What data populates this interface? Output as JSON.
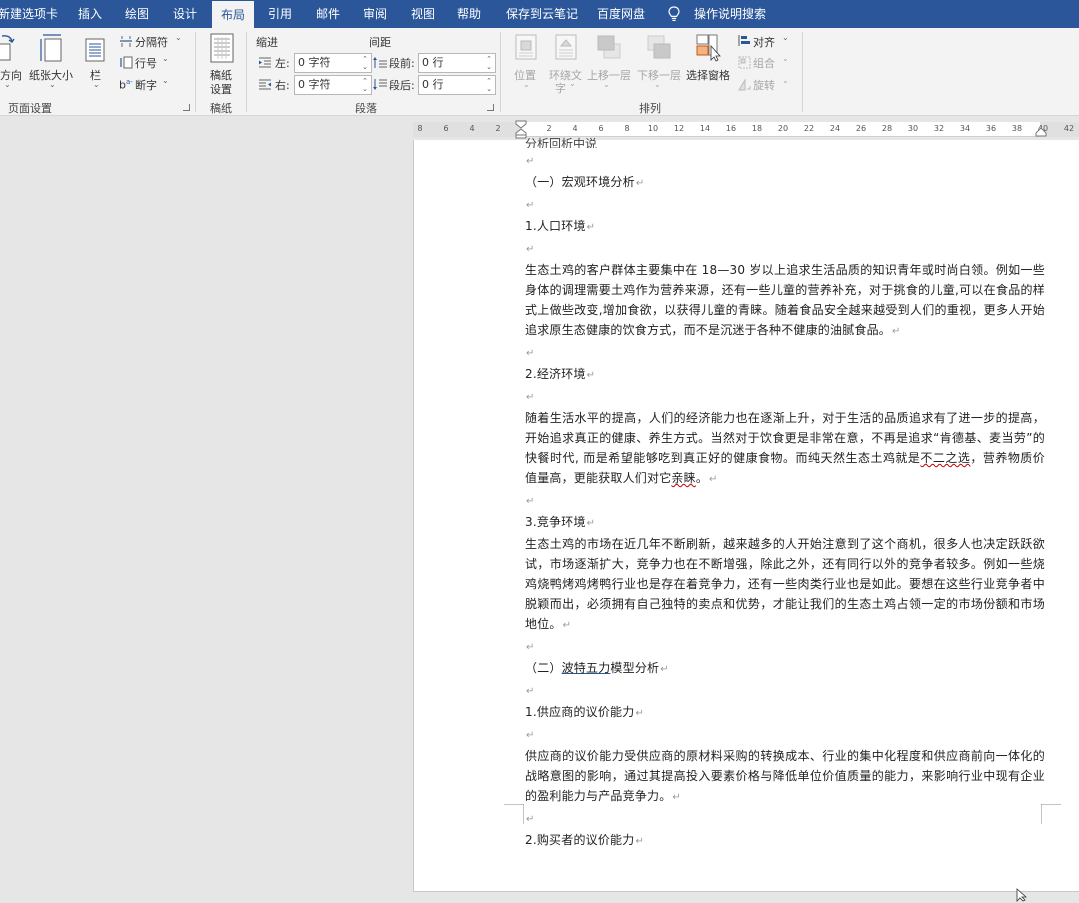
{
  "tabs": [
    {
      "label": "新建选项卡",
      "active": false
    },
    {
      "label": "插入",
      "active": false
    },
    {
      "label": "绘图",
      "active": false
    },
    {
      "label": "设计",
      "active": false
    },
    {
      "label": "布局",
      "active": true
    },
    {
      "label": "引用",
      "active": false
    },
    {
      "label": "邮件",
      "active": false
    },
    {
      "label": "审阅",
      "active": false
    },
    {
      "label": "视图",
      "active": false
    },
    {
      "label": "帮助",
      "active": false
    },
    {
      "label": "保存到云笔记",
      "active": false
    },
    {
      "label": "百度网盘",
      "active": false
    }
  ],
  "tell_me": "操作说明搜索",
  "ribbon": {
    "page_setup": {
      "orientation": "方向",
      "size": "纸张大小",
      "columns": "栏",
      "breaks": "分隔符",
      "line_numbers": "行号",
      "hyphenation": "断字",
      "group_label": "页面设置"
    },
    "manuscript": {
      "button_line1": "稿纸",
      "button_line2": "设置",
      "group_label": "稿纸"
    },
    "paragraph": {
      "indent_header": "缩进",
      "spacing_header": "间距",
      "left_label": "左:",
      "right_label": "右:",
      "left_value": "0 字符",
      "right_value": "0 字符",
      "before_label": "段前:",
      "after_label": "段后:",
      "before_value": "0 行",
      "after_value": "0 行",
      "group_label": "段落"
    },
    "arrange": {
      "position": "位置",
      "wrap_line1": "环绕文",
      "wrap_line2": "字",
      "bring_forward": "上移一层",
      "send_backward": "下移一层",
      "selection_pane": "选择窗格",
      "align": "对齐",
      "group": "组合",
      "rotate": "旋转",
      "group_label": "排列"
    }
  },
  "ruler": {
    "left_ticks": [
      "8",
      "6",
      "4",
      "2"
    ],
    "right_ticks": [
      "2",
      "4",
      "6",
      "8",
      "10",
      "12",
      "14",
      "16",
      "18",
      "20",
      "22",
      "24",
      "26",
      "28",
      "30",
      "32",
      "34",
      "36",
      "38",
      "40",
      "42"
    ]
  },
  "document": {
    "top_partial": "分析回析中说",
    "h_macro": "（一）宏观环境分析",
    "h_population": "1.人口环境",
    "p_population": "生态土鸡的客户群体主要集中在 18—30 岁以上追求生活品质的知识青年或时尚白领。例如一些身体的调理需要土鸡作为营养来源，还有一些儿童的营养补充，对于挑食的儿童,可以在食品的样式上做些改变,增加食欲，以获得儿童的青睐。随着食品安全越来越受到人们的重视，更多人开始追求原生态健康的饮食方式，而不是沉迷于各种不健康的油腻食品。",
    "h_economy": "2.经济环境",
    "p_economy_a": "随着生活水平的提高，人们的经济能力也在逐渐上升，对于生活的品质追求有了进一步的提高，开始追求真正的健康、养生方式。当然对于饮食更是非常在意，不再是追求“肯德基、麦当劳”的快餐时代, 而是希望能够吃到真正好的健康食物。而纯天然生态土鸡就是",
    "p_economy_b": "不二之选",
    "p_economy_c": "，营养物质价值量高，更能获取人们对它",
    "p_economy_d": "亲睐",
    "p_economy_e": "。",
    "h_competition": "3.竞争环境",
    "p_competition": "生态土鸡的市场在近几年不断刷新，越来越多的人开始注意到了这个商机，很多人也决定跃跃欲试，市场逐渐扩大，竞争力也在不断增强，除此之外，还有同行以外的竞争者较多。例如一些烧鸡烧鸭烤鸡烤鸭行业也是存在着竞争力，还有一些肉类行业也是如此。要想在这些行业竞争者中脱颖而出，必须拥有自己独特的卖点和优势，才能让我们的生态土鸡占领一定的市场份额和市场地位。",
    "h_porter_a": "（二）",
    "h_porter_b": "波特五力",
    "h_porter_c": "模型分析",
    "h_supplier": "1.供应商的议价能力",
    "p_supplier": "供应商的议价能力受供应商的原材料采购的转换成本、行业的集中化程度和供应商前向一体化的战略意图的影响，通过其提高投入要素价格与降低单位价值质量的能力，来影响行业中现有企业的盈利能力与产品竞争力。",
    "h_buyer": "2.购买者的议价能力",
    "para_mark": "↵"
  }
}
